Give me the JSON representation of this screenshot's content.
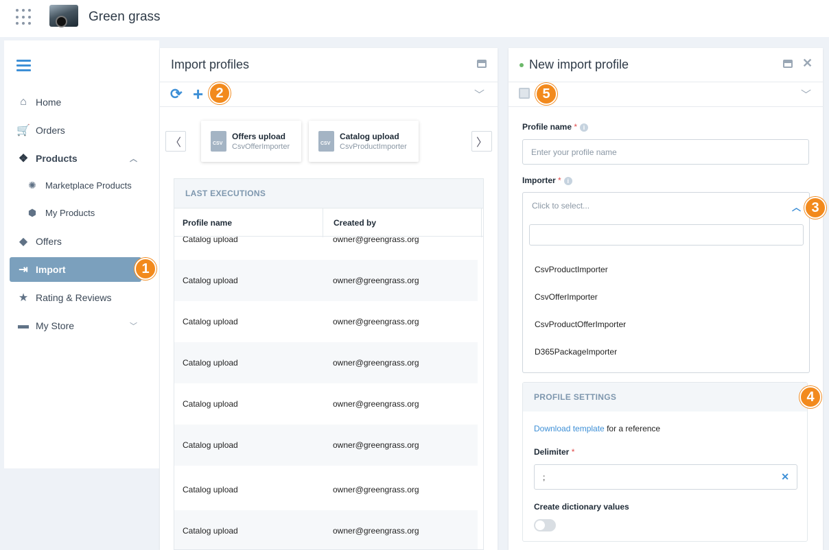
{
  "app": {
    "title": "Green grass"
  },
  "sidebar": {
    "items": [
      {
        "label": "Home",
        "icon": "home-icon"
      },
      {
        "label": "Orders",
        "icon": "cart-icon"
      },
      {
        "label": "Products",
        "icon": "products-icon"
      },
      {
        "label": "Marketplace Products",
        "icon": "marketplace-icon"
      },
      {
        "label": "My Products",
        "icon": "box-icon"
      },
      {
        "label": "Offers",
        "icon": "offers-icon"
      },
      {
        "label": "Import",
        "icon": "import-icon"
      },
      {
        "label": "Rating & Reviews",
        "icon": "star-icon"
      },
      {
        "label": "My Store",
        "icon": "store-icon"
      }
    ]
  },
  "badges": [
    "1",
    "2",
    "3",
    "4",
    "5"
  ],
  "import_profiles": {
    "title": "Import profiles",
    "cards": [
      {
        "name": "Offers upload",
        "importer": "CsvOfferImporter"
      },
      {
        "name": "Catalog upload",
        "importer": "CsvProductImporter"
      }
    ],
    "executions": {
      "title": "LAST EXECUTIONS",
      "columns": [
        "Profile name",
        "Created by"
      ],
      "rows": [
        [
          "Catalog upload",
          "owner@greengrass.org"
        ],
        [
          "Catalog upload",
          "owner@greengrass.org"
        ],
        [
          "Catalog upload",
          "owner@greengrass.org"
        ],
        [
          "Catalog upload",
          "owner@greengrass.org"
        ],
        [
          "Catalog upload",
          "owner@greengrass.org"
        ],
        [
          "Catalog upload",
          "owner@greengrass.org"
        ],
        [
          "Catalog upload",
          "owner@greengrass.org"
        ],
        [
          "Catalog upload",
          "owner@greengrass.org"
        ]
      ]
    }
  },
  "new_profile": {
    "title": "New import profile",
    "profile_name_label": "Profile name",
    "profile_name_placeholder": "Enter your profile name",
    "importer_label": "Importer",
    "importer_placeholder": "Click to select...",
    "importer_options": [
      "CsvProductImporter",
      "CsvOfferImporter",
      "CsvProductOfferImporter",
      "D365PackageImporter"
    ],
    "settings_title": "PROFILE SETTINGS",
    "download_link": "Download template",
    "download_suffix": " for a reference",
    "delimiter_label": "Delimiter",
    "delimiter_value": ";",
    "dictionary_label": "Create dictionary values"
  },
  "colors": {
    "accent": "#3d8fd6",
    "badge": "#f28a1d",
    "active_nav": "#7ba0bd"
  }
}
